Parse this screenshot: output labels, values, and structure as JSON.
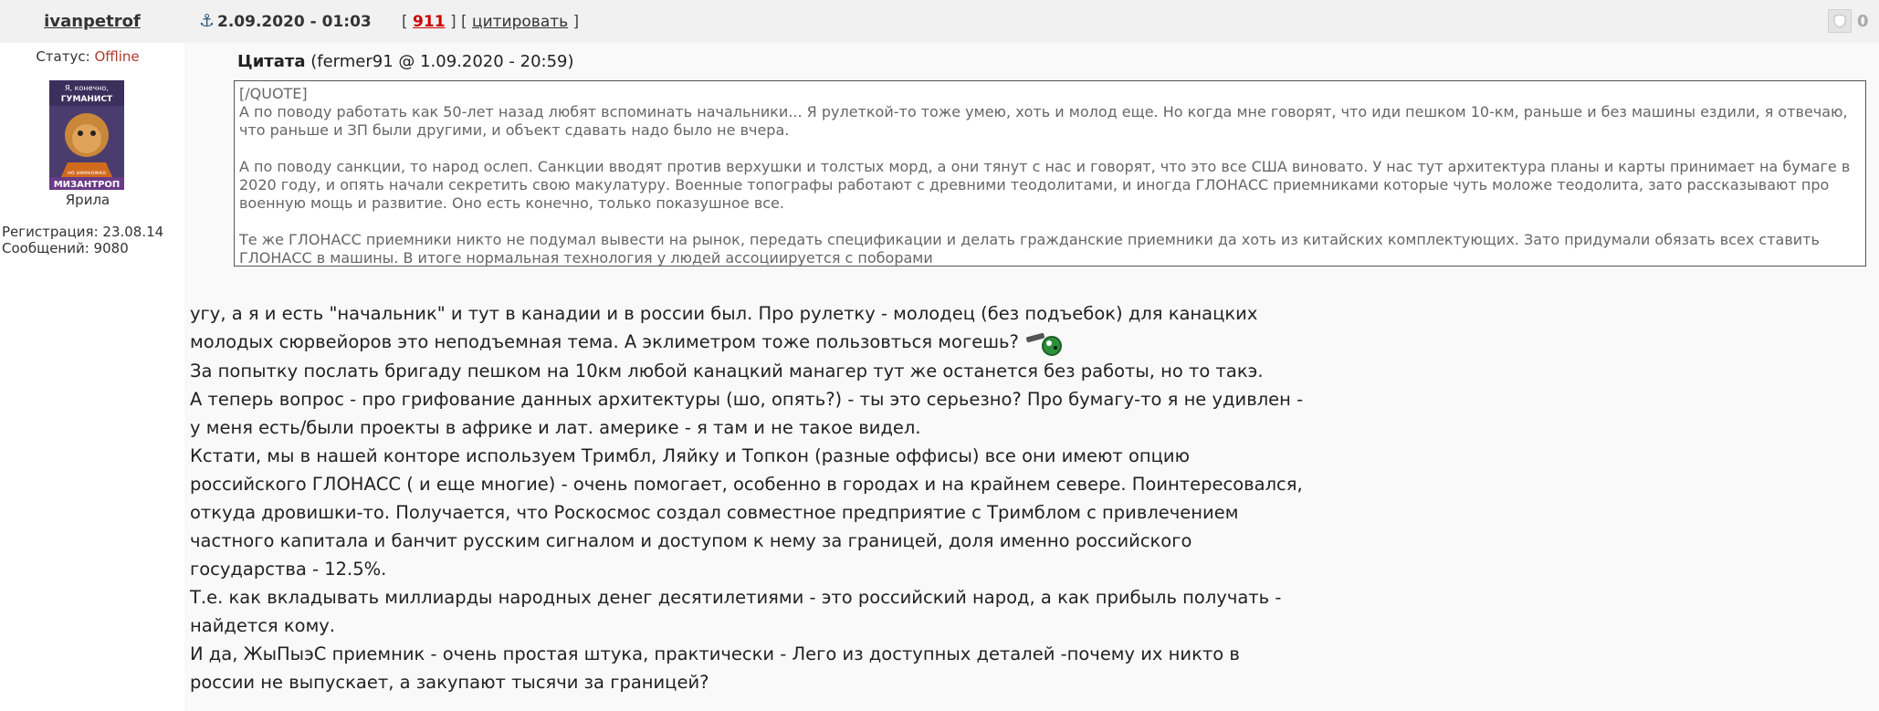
{
  "author": {
    "username": "ivanpetrof",
    "status_label": "Статус:",
    "status_value": "Offline",
    "avatar_lines": [
      "Я, конечно,",
      "ГУМАНИСТ",
      "но немножко",
      "МИЗАНТРОП"
    ],
    "avatar_caption": "Ярила",
    "registration": "Регистрация: 23.08.14",
    "messages": "Сообщений: 9080"
  },
  "header": {
    "anchor_icon": "anchor-icon",
    "date": "2.09.2020 - 01:03",
    "post_number": "911",
    "quote_link": "цитировать",
    "rating": "0"
  },
  "quote": {
    "title": "Цитата",
    "meta": "(fermer91 @ 1.09.2020 - 20:59)",
    "tag": "[/QUOTE]",
    "p1": "А по поводу работать как 50-лет назад любят вспоминать начальники... Я рулеткой-то тоже умею, хоть и молод еще. Но когда мне говорят, что иди пешком 10-км, раньше и без машины ездили, я отвечаю, что раньше и ЗП были другими, и объект сдавать надо было не вчера.",
    "p2": "А по поводу санкции, то народ ослеп. Санкции вводят против верхушки и толстых морд, а они тянут с нас и говорят, что это все США виновато. У нас тут архитектура планы и карты принимает на бумаге в 2020 году, и опять начали секретить свою макулатуру. Военные топографы работают с древними теодолитами, и иногда ГЛОНАСС приемниками которые чуть моложе теодолита, зато рассказывают про военную мощь и развитие. Оно есть конечно, только показушное все.",
    "p3": "Те же ГЛОНАСС приемники никто не подумал вывести на рынок, передать спецификации и делать гражданские приемники да хоть из китайских комплектующих. Зато придумали обязать всех ставить ГЛОНАСС в машины. В итоге нормальная технология у людей ассоциируется с поборами"
  },
  "body": {
    "p1": "угу, а я и есть \"начальник\" и тут в канадии и в россии был. Про рулетку - молодец (без подъебок) для канацких молодых сюрвейоров это неподъемная тема. А эклиметром тоже пользовться могешь?",
    "p2": "За попытку послать бригаду пешком на 10км любой канацкий манагер тут же останется без работы, но то такэ.",
    "p3": "А теперь вопрос - про грифование данных архитектуры (шо, опять?) - ты это серьезно? Про бумагу-то я не удивлен - у меня есть/были проекты в африке и лат. америке - я там и не такое видел.",
    "p4": "Кстати, мы в нашей конторе используем Тримбл, Ляйку и Топкон (разные оффисы) все они имеют опцию российского ГЛОНАСС ( и еще многие) - очень помогает, особенно в городах и на крайнем севере. Поинтересовался, откуда дровишки-то. Получается, что Роскосмос создал совместное предприятие с Тримблом с привлечением частного капитала и банчит русским сигналом и доступом к нему за границей, доля именно российского государства - 12.5%.",
    "p5": "Т.е. как вкладывать миллиарды народных денег десятилетиями - это российский народ, а как прибыль получать - найдется кому.",
    "p6": "И да, ЖыПыэС приемник - очень простая штука, практически - Лего из доступных деталей -почему их никто в россии не выпускает, а закупают тысячи за границей?"
  },
  "colors": {
    "offline": "#b03a2e",
    "post_number": "#cc0000",
    "header_bg": "#f1f1f1"
  }
}
